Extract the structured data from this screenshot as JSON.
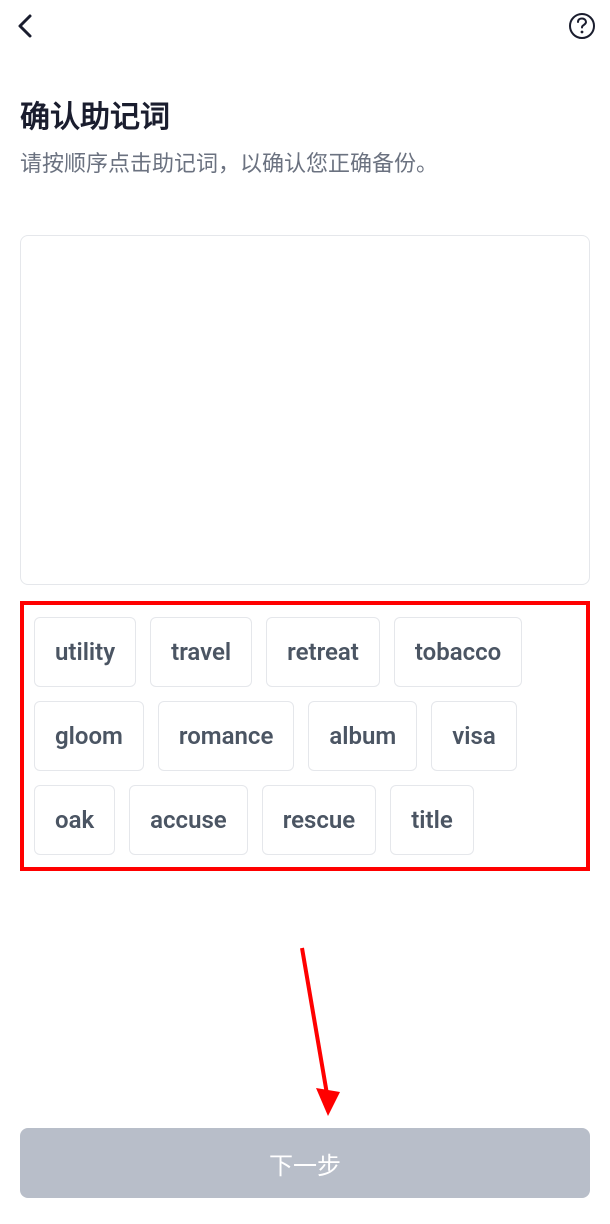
{
  "header": {
    "back_icon": "chevron-left",
    "help_icon": "question-circle"
  },
  "title": "确认助记词",
  "subtitle": "请按顺序点击助记词，以确认您正确备份。",
  "mnemonic_words": [
    "utility",
    "travel",
    "retreat",
    "tobacco",
    "gloom",
    "romance",
    "album",
    "visa",
    "oak",
    "accuse",
    "rescue",
    "title"
  ],
  "next_button_label": "下一步",
  "annotations": {
    "highlight_box_color": "#ff0000",
    "arrow_color": "#ff0000"
  }
}
